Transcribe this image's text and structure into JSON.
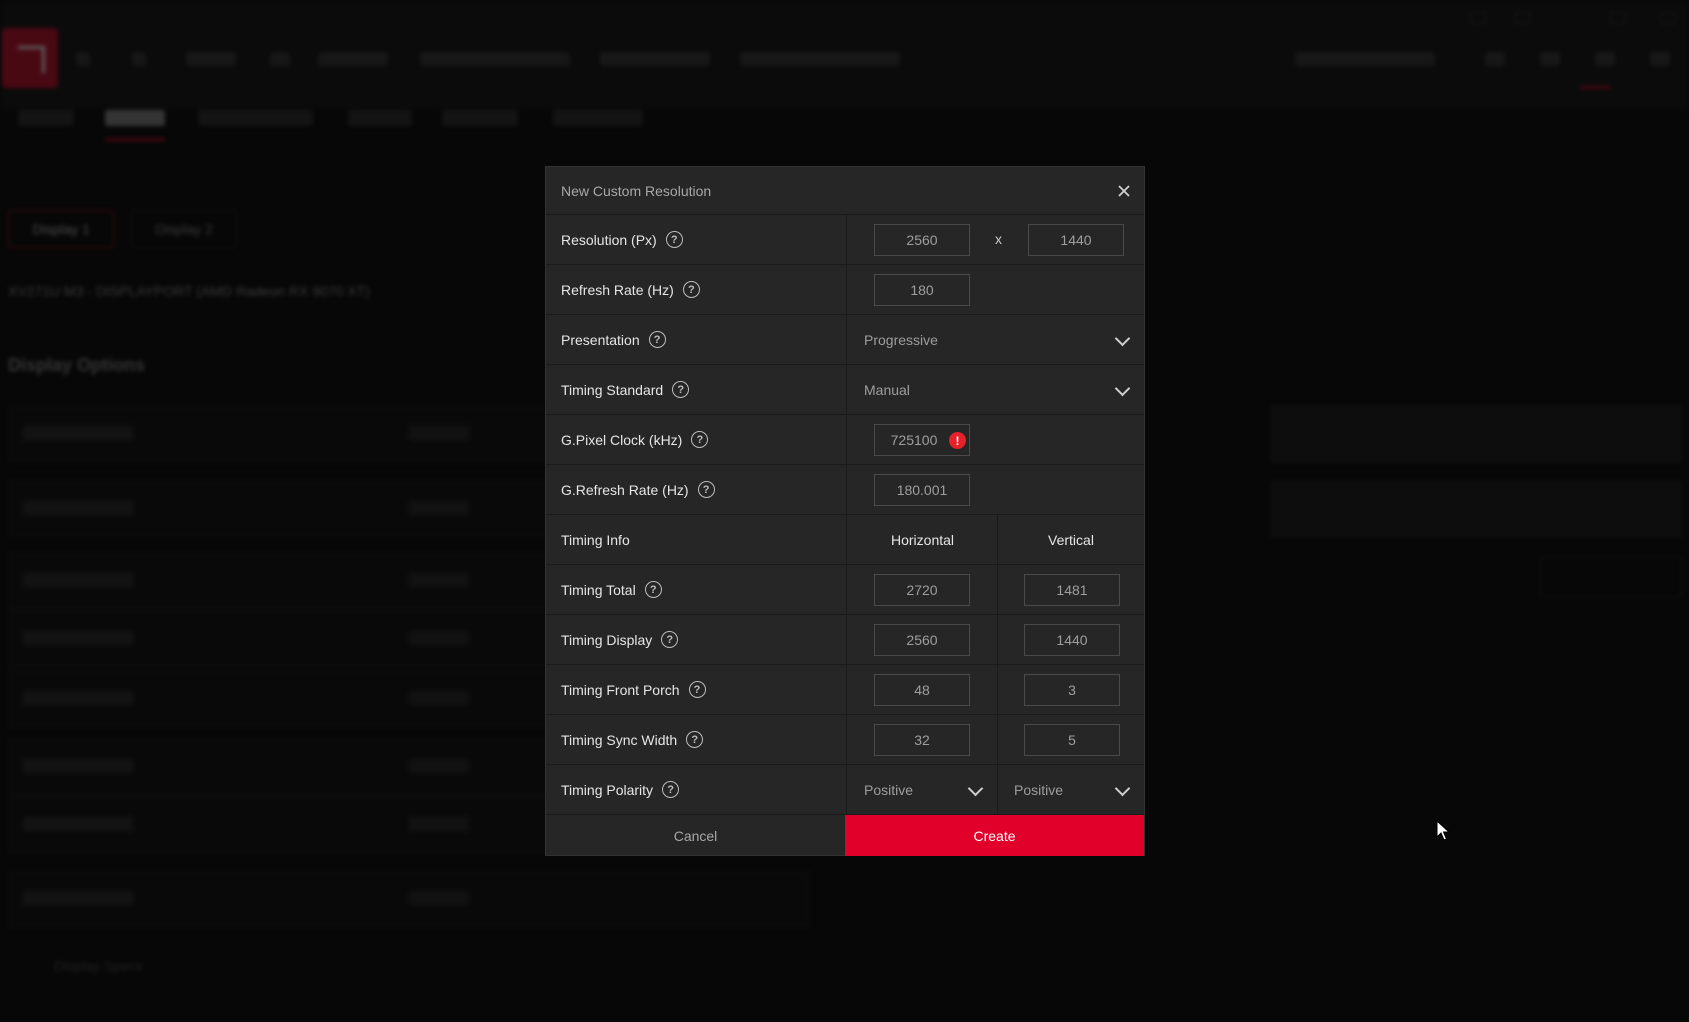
{
  "background": {
    "display_buttons": [
      "Display 1",
      "Display 2"
    ],
    "monitor_name": "XV271U M3 - DISPLAYPORT (AMD Radeon RX 9070 XT)",
    "section_title": "Display Options",
    "display_specs": "Display Specs"
  },
  "modal": {
    "title": "New Custom Resolution",
    "close_icon": "close-icon",
    "resolution": {
      "label": "Resolution (Px)",
      "width": "2560",
      "separator": "x",
      "height": "1440"
    },
    "refresh_rate": {
      "label": "Refresh Rate (Hz)",
      "value": "180"
    },
    "presentation": {
      "label": "Presentation",
      "value": "Progressive"
    },
    "timing_standard": {
      "label": "Timing Standard",
      "value": "Manual"
    },
    "pixel_clock": {
      "label": "G.Pixel Clock (kHz)",
      "value": "725100",
      "error_icon": "!"
    },
    "g_refresh_rate": {
      "label": "G.Refresh Rate (Hz)",
      "value": "180.001"
    },
    "timing_info": {
      "label": "Timing Info",
      "horizontal": "Horizontal",
      "vertical": "Vertical"
    },
    "timing_total": {
      "label": "Timing Total",
      "h": "2720",
      "v": "1481"
    },
    "timing_display": {
      "label": "Timing Display",
      "h": "2560",
      "v": "1440"
    },
    "timing_front_porch": {
      "label": "Timing Front Porch",
      "h": "48",
      "v": "3"
    },
    "timing_sync_width": {
      "label": "Timing Sync Width",
      "h": "32",
      "v": "5"
    },
    "timing_polarity": {
      "label": "Timing Polarity",
      "h": "Positive",
      "v": "Positive"
    },
    "help_glyph": "?",
    "cancel_label": "Cancel",
    "create_label": "Create"
  },
  "colors": {
    "accent": "#e0002a",
    "error": "#e8202a",
    "modal_bg": "#262626"
  }
}
